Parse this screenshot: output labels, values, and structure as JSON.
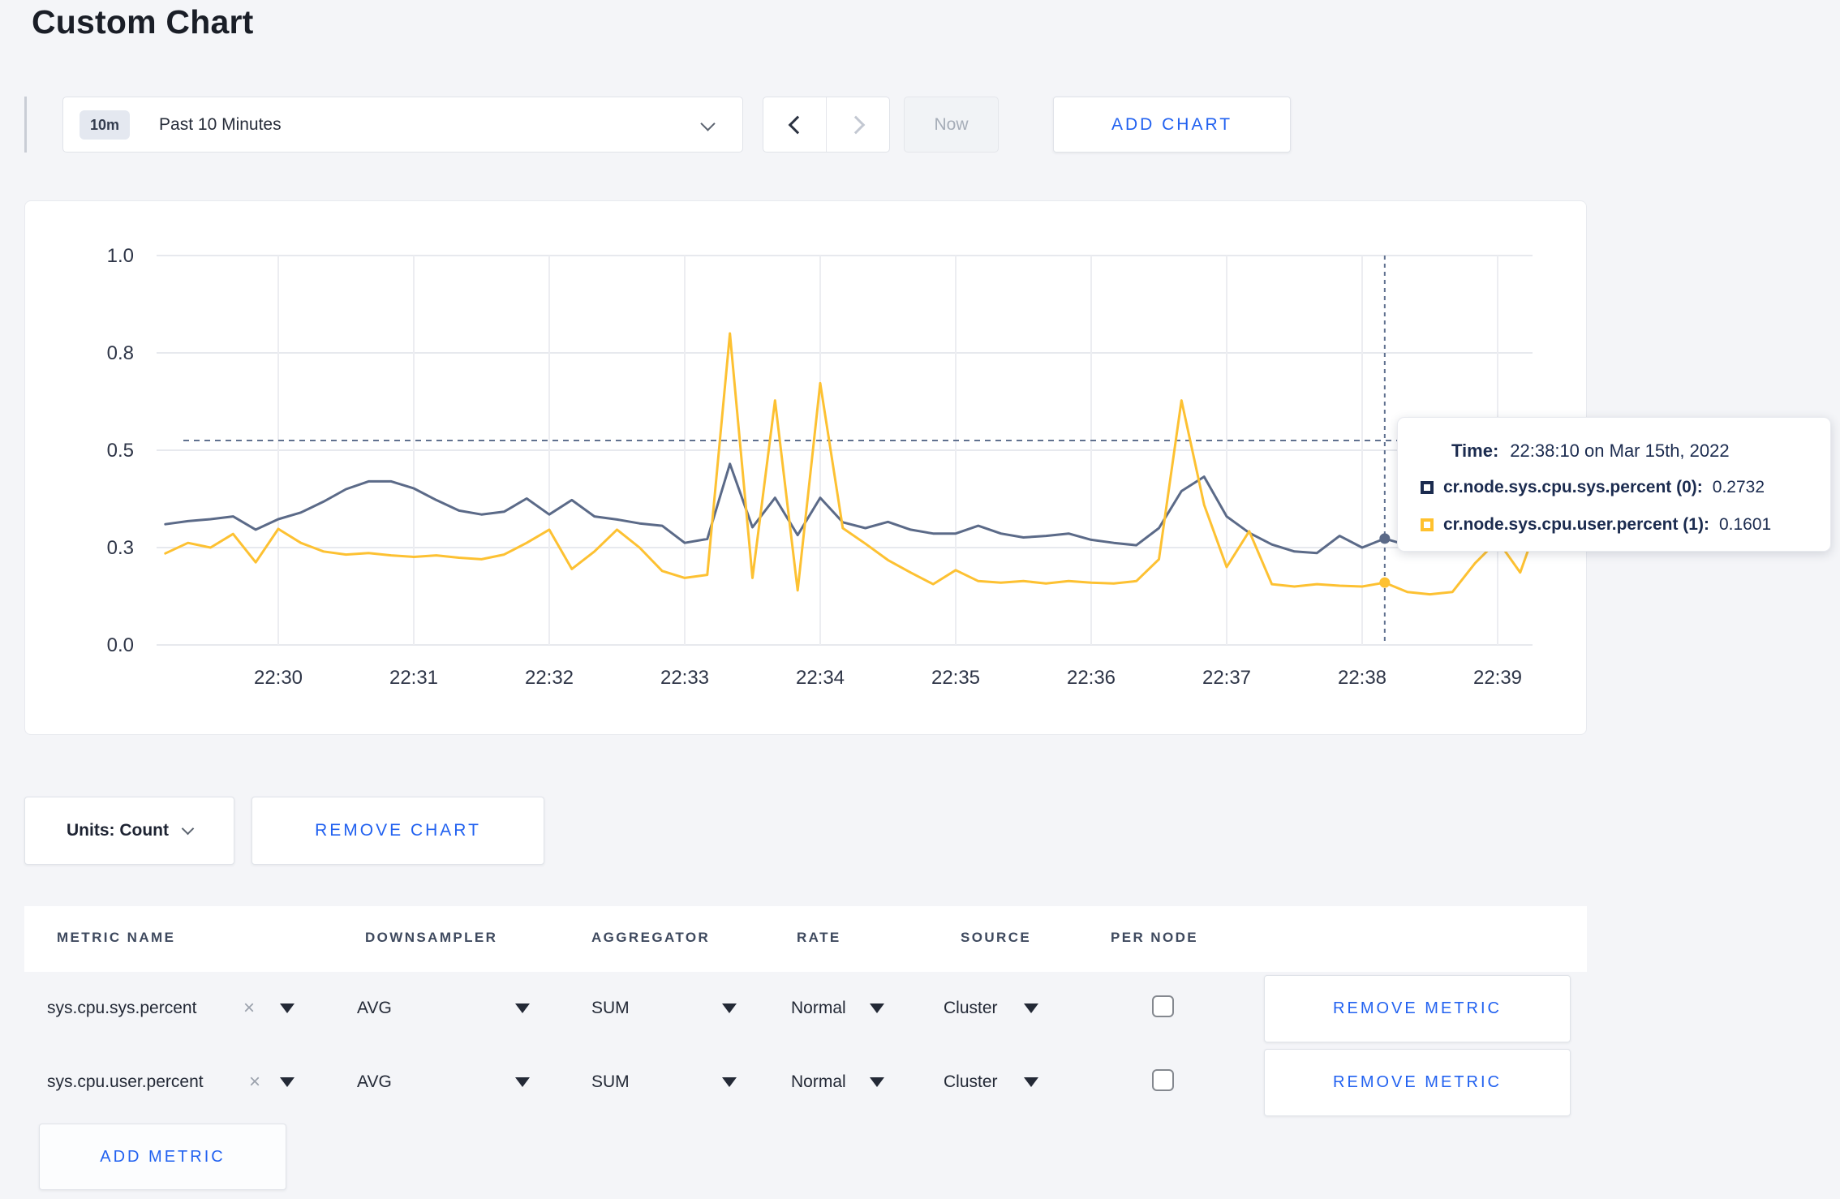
{
  "page": {
    "title": "Custom Chart"
  },
  "toolbar": {
    "range_badge": "10m",
    "range_label": "Past 10 Minutes",
    "now_label": "Now",
    "add_chart_label": "ADD CHART"
  },
  "chart_controls": {
    "units_label": "Units: Count",
    "remove_chart_label": "REMOVE CHART"
  },
  "tooltip": {
    "time_label": "Time:",
    "time_value": "22:38:10 on Mar 15th, 2022",
    "series": [
      {
        "name": "cr.node.sys.cpu.sys.percent (0):",
        "value": "0.2732",
        "color": "#1b2b4f"
      },
      {
        "name": "cr.node.sys.cpu.user.percent (1):",
        "value": "0.1601",
        "color": "#ffc12e"
      }
    ]
  },
  "metrics_table": {
    "headers": [
      "METRIC NAME",
      "DOWNSAMPLER",
      "AGGREGATOR",
      "RATE",
      "SOURCE",
      "PER NODE"
    ],
    "clear_icon": "×",
    "rows": [
      {
        "metric": "sys.cpu.sys.percent",
        "downsampler": "AVG",
        "aggregator": "SUM",
        "rate": "Normal",
        "source": "Cluster",
        "per_node_checked": false,
        "remove_label": "REMOVE METRIC"
      },
      {
        "metric": "sys.cpu.user.percent",
        "downsampler": "AVG",
        "aggregator": "SUM",
        "rate": "Normal",
        "source": "Cluster",
        "per_node_checked": false,
        "remove_label": "REMOVE METRIC"
      }
    ],
    "add_metric_label": "ADD METRIC"
  },
  "chart_data": {
    "type": "line",
    "title": "Custom Chart: sys.cpu.sys.percent & sys.cpu.user.percent",
    "ylim": [
      0,
      1
    ],
    "grid": true,
    "y_ticks": [
      {
        "v": 0.0,
        "label": "0.0"
      },
      {
        "v": 0.25,
        "label": "0.3"
      },
      {
        "v": 0.5,
        "label": "0.5"
      },
      {
        "v": 0.75,
        "label": "0.8"
      },
      {
        "v": 1.0,
        "label": "1.0"
      }
    ],
    "x_ticks": [
      {
        "t": 0,
        "label": "22:30"
      },
      {
        "t": 60,
        "label": "22:31"
      },
      {
        "t": 120,
        "label": "22:32"
      },
      {
        "t": 180,
        "label": "22:33"
      },
      {
        "t": 240,
        "label": "22:34"
      },
      {
        "t": 300,
        "label": "22:35"
      },
      {
        "t": 360,
        "label": "22:36"
      },
      {
        "t": 420,
        "label": "22:37"
      },
      {
        "t": 480,
        "label": "22:38"
      },
      {
        "t": 540,
        "label": "22:39"
      }
    ],
    "hover_value_line": 0.525,
    "crosshair_t": 490,
    "crosshair_time": "22:38:10",
    "series": [
      {
        "name": "cr.node.sys.cpu.sys.percent",
        "color": "#5b6a88",
        "hover_value": 0.2732,
        "points": [
          [
            -50,
            0.31
          ],
          [
            -40,
            0.318
          ],
          [
            -30,
            0.323
          ],
          [
            -20,
            0.33
          ],
          [
            -10,
            0.296
          ],
          [
            0,
            0.323
          ],
          [
            10,
            0.34
          ],
          [
            20,
            0.368
          ],
          [
            30,
            0.4
          ],
          [
            40,
            0.42
          ],
          [
            50,
            0.42
          ],
          [
            60,
            0.402
          ],
          [
            70,
            0.372
          ],
          [
            80,
            0.345
          ],
          [
            90,
            0.335
          ],
          [
            100,
            0.342
          ],
          [
            110,
            0.376
          ],
          [
            120,
            0.335
          ],
          [
            130,
            0.372
          ],
          [
            140,
            0.33
          ],
          [
            150,
            0.322
          ],
          [
            160,
            0.312
          ],
          [
            170,
            0.306
          ],
          [
            180,
            0.262
          ],
          [
            190,
            0.272
          ],
          [
            200,
            0.465
          ],
          [
            210,
            0.302
          ],
          [
            220,
            0.378
          ],
          [
            230,
            0.282
          ],
          [
            240,
            0.378
          ],
          [
            250,
            0.315
          ],
          [
            260,
            0.3
          ],
          [
            270,
            0.316
          ],
          [
            280,
            0.296
          ],
          [
            290,
            0.286
          ],
          [
            300,
            0.286
          ],
          [
            310,
            0.306
          ],
          [
            320,
            0.286
          ],
          [
            330,
            0.276
          ],
          [
            340,
            0.28
          ],
          [
            350,
            0.286
          ],
          [
            360,
            0.27
          ],
          [
            370,
            0.262
          ],
          [
            380,
            0.256
          ],
          [
            390,
            0.3
          ],
          [
            400,
            0.395
          ],
          [
            410,
            0.432
          ],
          [
            420,
            0.33
          ],
          [
            430,
            0.288
          ],
          [
            440,
            0.258
          ],
          [
            450,
            0.24
          ],
          [
            460,
            0.236
          ],
          [
            470,
            0.28
          ],
          [
            480,
            0.25
          ],
          [
            490,
            0.2732
          ],
          [
            500,
            0.256
          ],
          [
            510,
            0.27
          ],
          [
            520,
            0.28
          ],
          [
            530,
            0.296
          ],
          [
            540,
            0.308
          ],
          [
            550,
            0.3
          ],
          [
            555,
            0.302
          ]
        ]
      },
      {
        "name": "cr.node.sys.cpu.user.percent",
        "color": "#fdc132",
        "hover_value": 0.1601,
        "points": [
          [
            -50,
            0.235
          ],
          [
            -40,
            0.262
          ],
          [
            -30,
            0.25
          ],
          [
            -20,
            0.285
          ],
          [
            -10,
            0.212
          ],
          [
            0,
            0.298
          ],
          [
            10,
            0.262
          ],
          [
            20,
            0.24
          ],
          [
            30,
            0.232
          ],
          [
            40,
            0.236
          ],
          [
            50,
            0.23
          ],
          [
            60,
            0.226
          ],
          [
            70,
            0.23
          ],
          [
            80,
            0.224
          ],
          [
            90,
            0.22
          ],
          [
            100,
            0.232
          ],
          [
            110,
            0.262
          ],
          [
            120,
            0.296
          ],
          [
            130,
            0.195
          ],
          [
            140,
            0.24
          ],
          [
            150,
            0.296
          ],
          [
            160,
            0.25
          ],
          [
            170,
            0.19
          ],
          [
            180,
            0.172
          ],
          [
            190,
            0.18
          ],
          [
            200,
            0.8
          ],
          [
            210,
            0.172
          ],
          [
            220,
            0.628
          ],
          [
            230,
            0.14
          ],
          [
            240,
            0.672
          ],
          [
            250,
            0.3
          ],
          [
            260,
            0.26
          ],
          [
            270,
            0.218
          ],
          [
            280,
            0.186
          ],
          [
            290,
            0.156
          ],
          [
            300,
            0.192
          ],
          [
            310,
            0.164
          ],
          [
            320,
            0.16
          ],
          [
            330,
            0.164
          ],
          [
            340,
            0.158
          ],
          [
            350,
            0.164
          ],
          [
            360,
            0.16
          ],
          [
            370,
            0.158
          ],
          [
            380,
            0.164
          ],
          [
            390,
            0.22
          ],
          [
            400,
            0.628
          ],
          [
            410,
            0.36
          ],
          [
            420,
            0.2
          ],
          [
            430,
            0.292
          ],
          [
            440,
            0.156
          ],
          [
            450,
            0.15
          ],
          [
            460,
            0.156
          ],
          [
            470,
            0.152
          ],
          [
            480,
            0.15
          ],
          [
            490,
            0.1601
          ],
          [
            500,
            0.136
          ],
          [
            510,
            0.13
          ],
          [
            520,
            0.136
          ],
          [
            530,
            0.21
          ],
          [
            540,
            0.268
          ],
          [
            550,
            0.186
          ],
          [
            555,
            0.268
          ]
        ]
      }
    ]
  }
}
